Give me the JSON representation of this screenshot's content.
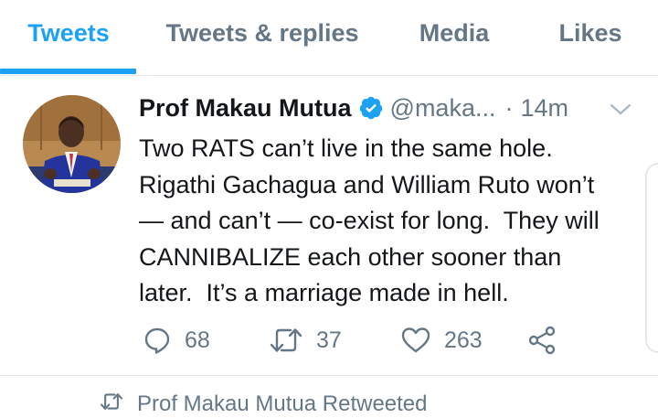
{
  "tabs": [
    {
      "label": "Tweets",
      "active": true
    },
    {
      "label": "Tweets & replies",
      "active": false
    },
    {
      "label": "Media",
      "active": false
    },
    {
      "label": "Likes",
      "active": false
    }
  ],
  "tweet": {
    "author_name": "Prof Makau Mutua",
    "verified": true,
    "handle": "@maka...",
    "separator": "·",
    "time": "14m",
    "text": "Two RATS can’t live in the same hole.\nRigathi Gachagua and William Ruto won’t\n— and can’t — co-exist for long.  They will\nCANNIBALIZE each other sooner than\nlater.  It’s a marriage made in hell.",
    "actions": {
      "reply_count": "68",
      "retweet_count": "37",
      "like_count": "263"
    }
  },
  "next_item": {
    "retweet_notice": "Prof Makau Mutua Retweeted"
  },
  "colors": {
    "accent": "#1da1f2",
    "secondary_text": "#657786",
    "primary_text": "#14171a",
    "divider": "#e1e8ed"
  },
  "icons": [
    "verified-badge-icon",
    "chevron-down-icon",
    "reply-icon",
    "retweet-icon",
    "heart-icon",
    "share-icon"
  ]
}
